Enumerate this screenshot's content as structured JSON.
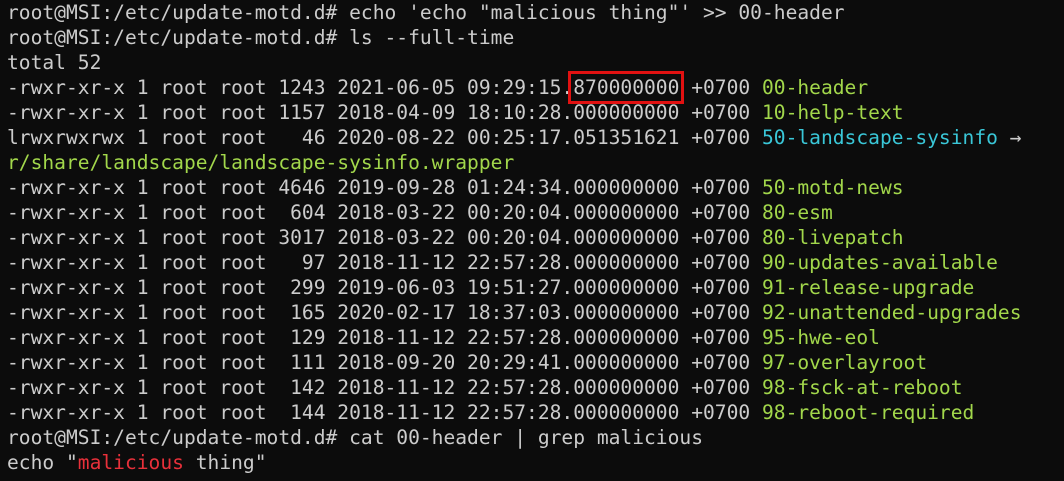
{
  "terminal": {
    "colors": {
      "background": "#0c0c0c",
      "default_text": "#cccccc",
      "executable": "#a2d74b",
      "symlink": "#3ac7d8",
      "grep_match": "#e8303a",
      "highlight_box": "#e11111"
    },
    "lines": [
      {
        "segments": [
          {
            "text": "root@MSI:/etc/update-motd.d# echo 'echo \"malicious thing\"' >> 00-header",
            "color": "default"
          }
        ]
      },
      {
        "segments": [
          {
            "text": "root@MSI:/etc/update-motd.d# ls --full-time",
            "color": "default"
          }
        ]
      },
      {
        "segments": [
          {
            "text": "total 52",
            "color": "default"
          }
        ]
      },
      {
        "segments": [
          {
            "text": "-rwxr-xr-x 1 root root 1243 2021-06-05 09:29:15.",
            "color": "default"
          },
          {
            "text": "870000000",
            "color": "default",
            "highlight": true
          },
          {
            "text": " +0700 ",
            "color": "default"
          },
          {
            "text": "00-header",
            "color": "green"
          }
        ]
      },
      {
        "segments": [
          {
            "text": "-rwxr-xr-x 1 root root 1157 2018-04-09 18:10:28.000000000 +0700 ",
            "color": "default"
          },
          {
            "text": "10-help-text",
            "color": "green"
          }
        ]
      },
      {
        "segments": [
          {
            "text": "lrwxrwxrwx 1 root root   46 2020-08-22 00:25:17.051351621 +0700 ",
            "color": "default"
          },
          {
            "text": "50-landscape-sysinfo",
            "color": "cyan"
          },
          {
            "text": " →",
            "color": "default"
          }
        ]
      },
      {
        "segments": [
          {
            "text": "r/share/landscape/landscape-sysinfo.wrapper",
            "color": "green"
          }
        ]
      },
      {
        "segments": [
          {
            "text": "-rwxr-xr-x 1 root root 4646 2019-09-28 01:24:34.000000000 +0700 ",
            "color": "default"
          },
          {
            "text": "50-motd-news",
            "color": "green"
          }
        ]
      },
      {
        "segments": [
          {
            "text": "-rwxr-xr-x 1 root root  604 2018-03-22 00:20:04.000000000 +0700 ",
            "color": "default"
          },
          {
            "text": "80-esm",
            "color": "green"
          }
        ]
      },
      {
        "segments": [
          {
            "text": "-rwxr-xr-x 1 root root 3017 2018-03-22 00:20:04.000000000 +0700 ",
            "color": "default"
          },
          {
            "text": "80-livepatch",
            "color": "green"
          }
        ]
      },
      {
        "segments": [
          {
            "text": "-rwxr-xr-x 1 root root   97 2018-11-12 22:57:28.000000000 +0700 ",
            "color": "default"
          },
          {
            "text": "90-updates-available",
            "color": "green"
          }
        ]
      },
      {
        "segments": [
          {
            "text": "-rwxr-xr-x 1 root root  299 2019-06-03 19:51:27.000000000 +0700 ",
            "color": "default"
          },
          {
            "text": "91-release-upgrade",
            "color": "green"
          }
        ]
      },
      {
        "segments": [
          {
            "text": "-rwxr-xr-x 1 root root  165 2020-02-17 18:37:03.000000000 +0700 ",
            "color": "default"
          },
          {
            "text": "92-unattended-upgrades",
            "color": "green"
          }
        ]
      },
      {
        "segments": [
          {
            "text": "-rwxr-xr-x 1 root root  129 2018-11-12 22:57:28.000000000 +0700 ",
            "color": "default"
          },
          {
            "text": "95-hwe-eol",
            "color": "green"
          }
        ]
      },
      {
        "segments": [
          {
            "text": "-rwxr-xr-x 1 root root  111 2018-09-20 20:29:41.000000000 +0700 ",
            "color": "default"
          },
          {
            "text": "97-overlayroot",
            "color": "green"
          }
        ]
      },
      {
        "segments": [
          {
            "text": "-rwxr-xr-x 1 root root  142 2018-11-12 22:57:28.000000000 +0700 ",
            "color": "default"
          },
          {
            "text": "98-fsck-at-reboot",
            "color": "green"
          }
        ]
      },
      {
        "segments": [
          {
            "text": "-rwxr-xr-x 1 root root  144 2018-11-12 22:57:28.000000000 +0700 ",
            "color": "default"
          },
          {
            "text": "98-reboot-required",
            "color": "green"
          }
        ]
      },
      {
        "segments": [
          {
            "text": "root@MSI:/etc/update-motd.d# cat 00-header | grep malicious",
            "color": "default"
          }
        ]
      },
      {
        "segments": [
          {
            "text": "echo \"",
            "color": "default"
          },
          {
            "text": "malicious",
            "color": "red"
          },
          {
            "text": " thing\"",
            "color": "default"
          }
        ]
      }
    ]
  }
}
